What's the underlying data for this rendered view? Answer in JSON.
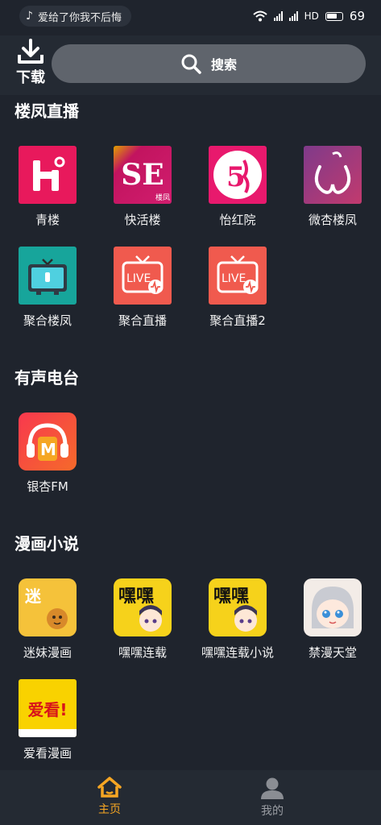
{
  "status_bar": {
    "now_playing": "爱给了你我不后悔",
    "network": "HD",
    "battery": "69"
  },
  "header": {
    "download_label": "下载",
    "search_placeholder": "搜索"
  },
  "sections": [
    {
      "title": "楼凤直播",
      "items": [
        {
          "label": "青楼",
          "icon": "qinglou-app-icon",
          "color": "#e8195c"
        },
        {
          "label": "快活楼",
          "icon": "kuaihuolou-app-icon",
          "color": "#c2145f"
        },
        {
          "label": "怡红院",
          "icon": "yihongyuan-app-icon",
          "color": "#e8196d"
        },
        {
          "label": "微杏楼凤",
          "icon": "weixing-app-icon",
          "color": "#b2377a"
        },
        {
          "label": "聚合楼凤",
          "icon": "tv-app-icon",
          "color": "#17a59b"
        },
        {
          "label": "聚合直播",
          "icon": "live-app-icon",
          "color": "#f05a4e"
        },
        {
          "label": "聚合直播2",
          "icon": "live2-app-icon",
          "color": "#f05a4e"
        }
      ]
    },
    {
      "title": "有声电台",
      "items": [
        {
          "label": "银杏FM",
          "icon": "headphones-app-icon",
          "color": "#f2475b"
        }
      ]
    },
    {
      "title": "漫画小说",
      "items": [
        {
          "label": "迷妹漫画",
          "icon": "mimei-app-icon",
          "color": "#f5c23a"
        },
        {
          "label": "嘿嘿连载",
          "icon": "heihei-app-icon",
          "color": "#f6d21b"
        },
        {
          "label": "嘿嘿连载小说",
          "icon": "heihei-novel-app-icon",
          "color": "#f6d21b"
        },
        {
          "label": "禁漫天堂",
          "icon": "jinman-app-icon",
          "color": "#f3ece7"
        },
        {
          "label": "爱看漫画",
          "icon": "aikan-app-icon",
          "color": "#f9d200"
        }
      ]
    }
  ],
  "icon_texts": {
    "kuaihuolou": "SE",
    "kuaihuolou_tag": "楼凤",
    "yihongyuan": "5",
    "live": "LIVE",
    "fm": "M",
    "mimei": "迷",
    "heihei": "嘿嘿",
    "aikan": "爱看!"
  },
  "bottom_nav": {
    "home_label": "主页",
    "mine_label": "我的",
    "active_color": "#f6a623"
  }
}
